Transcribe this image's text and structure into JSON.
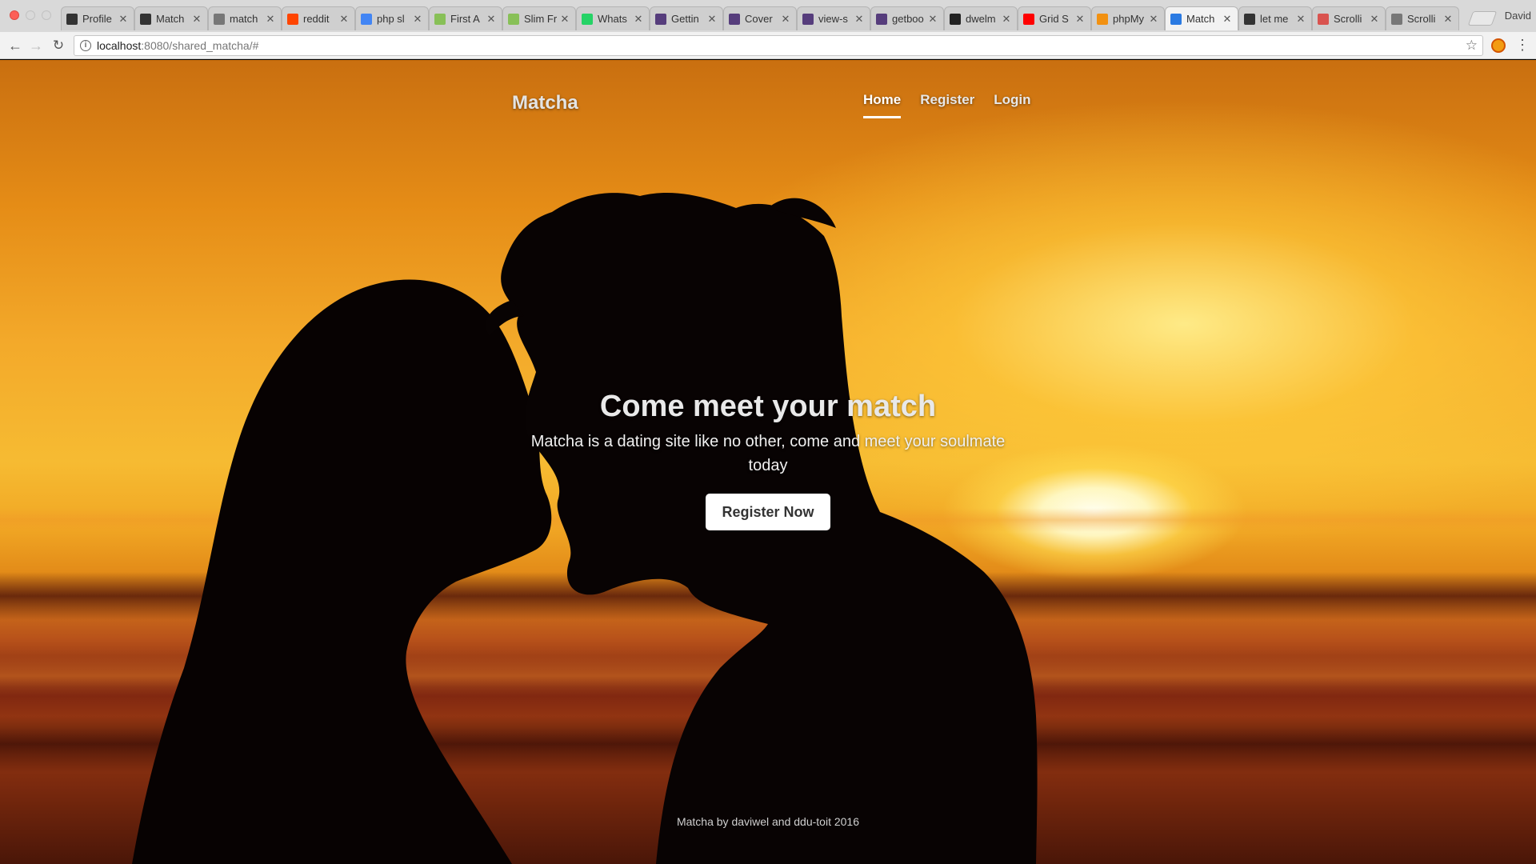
{
  "browser": {
    "tabs": [
      {
        "label": "Profile",
        "icon": "pinned-app-icon",
        "color": "#333333"
      },
      {
        "label": "Match",
        "icon": "pinned-app-icon",
        "color": "#333333"
      },
      {
        "label": "match",
        "icon": "document-icon",
        "color": "#777777"
      },
      {
        "label": "reddit",
        "icon": "reddit-icon",
        "color": "#ff4500"
      },
      {
        "label": "php sl",
        "icon": "google-icon",
        "color": "#4285f4"
      },
      {
        "label": "First A",
        "icon": "slim-icon",
        "color": "#88c057"
      },
      {
        "label": "Slim Fr",
        "icon": "slim-icon",
        "color": "#88c057"
      },
      {
        "label": "Whats",
        "icon": "whatsapp-icon",
        "color": "#25d366"
      },
      {
        "label": "Gettin",
        "icon": "bootstrap-icon",
        "color": "#563d7c"
      },
      {
        "label": "Cover",
        "icon": "bootstrap-icon",
        "color": "#563d7c"
      },
      {
        "label": "view-s",
        "icon": "bootstrap-icon",
        "color": "#563d7c"
      },
      {
        "label": "getboo",
        "icon": "bootstrap-icon",
        "color": "#563d7c"
      },
      {
        "label": "dwelm",
        "icon": "github-icon",
        "color": "#222222"
      },
      {
        "label": "Grid S",
        "icon": "youtube-icon",
        "color": "#ff0000"
      },
      {
        "label": "phpMy",
        "icon": "phpmyadmin-icon",
        "color": "#f29111"
      },
      {
        "label": "Match",
        "icon": "matcha-icon",
        "color": "#2a7ae2",
        "active": true
      },
      {
        "label": "let me",
        "icon": "info-icon",
        "color": "#333333"
      },
      {
        "label": "Scrolli",
        "icon": "scroll-icon",
        "color": "#d9534f"
      },
      {
        "label": "Scrolli",
        "icon": "document-icon",
        "color": "#777777"
      }
    ],
    "profile_name": "David",
    "url_host": "localhost",
    "url_path": ":8080/shared_matcha/#",
    "close_glyph": "✕"
  },
  "site": {
    "brand": "Matcha",
    "nav": {
      "home": "Home",
      "register": "Register",
      "login": "Login"
    },
    "hero": {
      "title": "Come meet your match",
      "lead": "Matcha is a dating site like no other, come and meet your soulmate today",
      "button": "Register Now"
    },
    "footer": "Matcha by daviwel and ddu-toit 2016"
  },
  "colors": {
    "sky_orange": "#f3a92a",
    "sun": "#fffbe0",
    "silhouette": "#080303"
  }
}
